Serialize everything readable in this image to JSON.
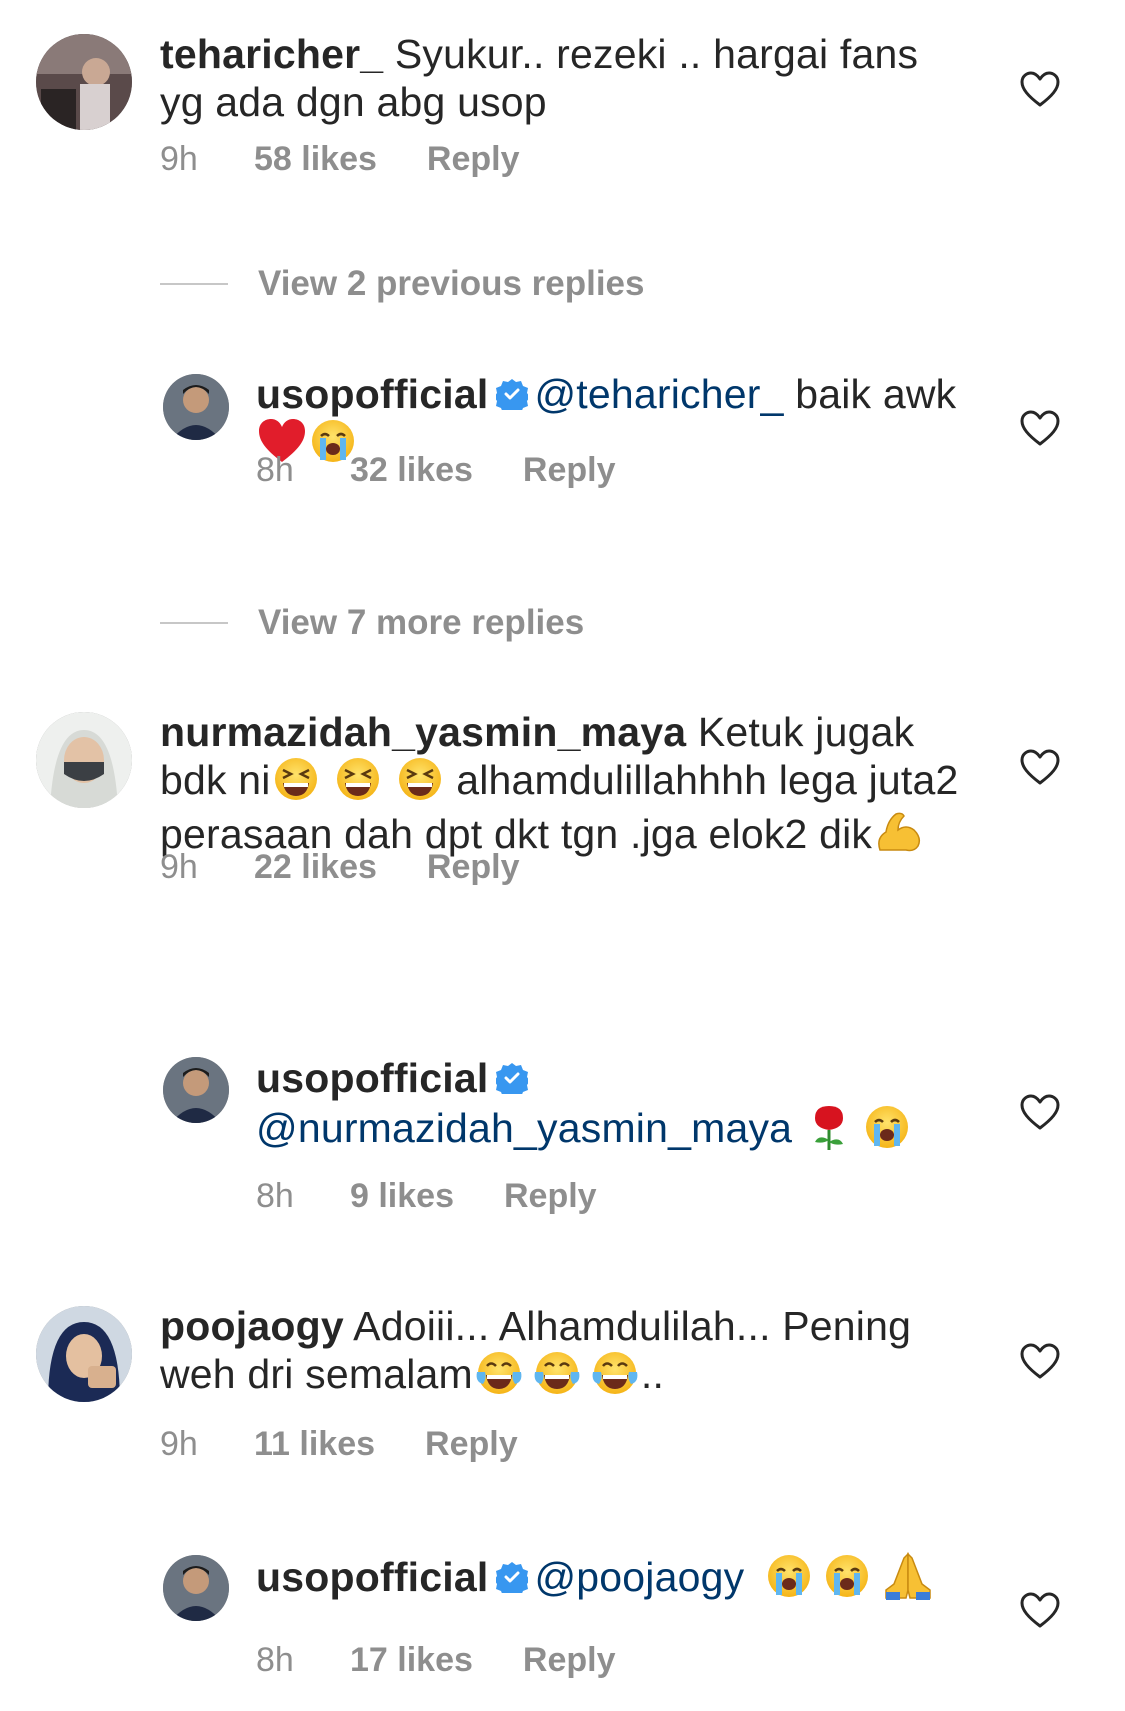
{
  "comments": [
    {
      "username": "teharicher_",
      "text": " Syukur.. rezeki .. hargai fans yg ada dgn abg usop",
      "time": "9h",
      "likes": "58 likes",
      "reply": "Reply",
      "avatar_icon": "avatar-photo-car"
    },
    {
      "username": "usopofficial",
      "mention": "@teharicher_",
      "text_a": " baik awk",
      "emoji": [
        "red-heart",
        "loudly-crying-face"
      ],
      "time": "8h",
      "likes": "32 likes",
      "reply": "Reply"
    },
    {
      "username": "nurmazidah_yasmin_maya",
      "text_a": " Ketuk jugak bdk ni",
      "emoji_a": [
        "grinning-squinting-face",
        "grinning-squinting-face",
        "grinning-squinting-face"
      ],
      "text_b": " alhamdulillahhhh lega juta2 perasaan dah dpt dkt tgn .jga elok2 dik",
      "emoji_b": [
        "flexed-biceps"
      ],
      "time": "9h",
      "likes": "22 likes",
      "reply": "Reply"
    },
    {
      "username": "usopofficial",
      "mention": "@nurmazidah_yasmin_maya",
      "emoji": [
        "rose",
        "loudly-crying-face"
      ],
      "time": "8h",
      "likes": "9 likes",
      "reply": "Reply"
    },
    {
      "username": "poojaogy",
      "text_a": " Adoiii... Alhamdulilah... Pening weh dri semalam",
      "emoji": [
        "face-with-tears-of-joy",
        "face-with-tears-of-joy",
        "face-with-tears-of-joy"
      ],
      "text_b": "..",
      "time": "9h",
      "likes": "11 likes",
      "reply": "Reply"
    },
    {
      "username": "usopofficial",
      "mention": "@poojaogy",
      "emoji": [
        "loudly-crying-face",
        "loudly-crying-face",
        "folded-hands"
      ],
      "time": "8h",
      "likes": "17 likes",
      "reply": "Reply"
    }
  ],
  "view_previous": "View 2 previous replies",
  "view_more": "View 7 more replies",
  "colors": {
    "text": "#262626",
    "muted": "#8e8e8e",
    "mention": "#00376b",
    "verified": "#3897f0"
  }
}
